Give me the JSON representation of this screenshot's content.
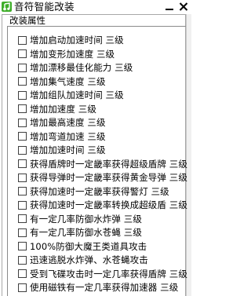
{
  "app": {
    "title": "音符智能改装"
  },
  "group": {
    "label": "改装属性"
  },
  "options": [
    {
      "label": "增加启动加速时间 三级",
      "checked": false
    },
    {
      "label": "增加变形加速度 三级",
      "checked": false
    },
    {
      "label": "增加漂移最佳化能力 三级",
      "checked": false
    },
    {
      "label": "增加集气速度 三级",
      "checked": false
    },
    {
      "label": "增加组队加速时间 三级",
      "checked": false
    },
    {
      "label": "增加加速度 三级",
      "checked": false
    },
    {
      "label": "增加最高速度 三级",
      "checked": false
    },
    {
      "label": "增加弯道加速 三级",
      "checked": false
    },
    {
      "label": "增加加速时间 三级",
      "checked": false
    },
    {
      "label": "获得盾牌时一定畿率获得超级盾牌 三级",
      "checked": false
    },
    {
      "label": "获得导弹时一定畿率获得黄金导弹 三级",
      "checked": false
    },
    {
      "label": "获得加速时一定畿率获得警灯 三级",
      "checked": false
    },
    {
      "label": "获得加速时一定畿率转换成超级盾 三级",
      "checked": false
    },
    {
      "label": "有一定几率防御水炸弹 三级",
      "checked": false
    },
    {
      "label": "有一定几率防御水苍蝇 三级",
      "checked": false
    },
    {
      "label": "100%防御大魔王类道具攻击",
      "checked": false
    },
    {
      "label": "迅速逃脱水炸弹、水苍蝇攻击",
      "checked": false
    },
    {
      "label": "受到飞碟攻击时一定几率获得盾牌 三级",
      "checked": false
    },
    {
      "label": "使用磁铁有一定几率获得加速器 三级",
      "checked": false
    }
  ],
  "colors": {
    "icon_green": "#3fae2a",
    "icon_dark_green": "#1e6b14"
  }
}
